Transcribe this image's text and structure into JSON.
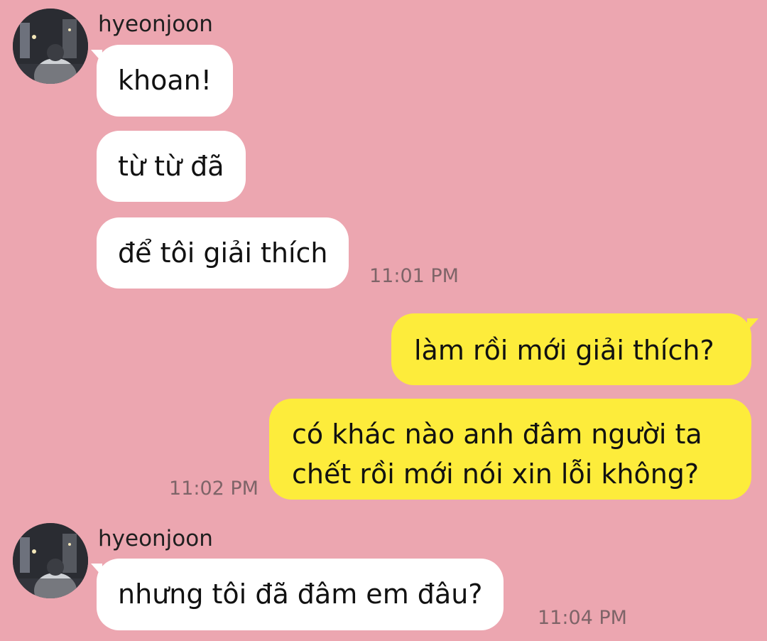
{
  "chat": {
    "groups": [
      {
        "sender": "hyeonjoon",
        "direction": "incoming",
        "messages": [
          "khoan!",
          "từ từ đã",
          "để tôi giải thích"
        ],
        "time": "11:01 PM"
      },
      {
        "sender": "",
        "direction": "outgoing",
        "messages": [
          "làm rồi mới giải thích?",
          "có khác nào anh đâm người ta chết rồi mới nói xin lỗi không?"
        ],
        "time": "11:02 PM"
      },
      {
        "sender": "hyeonjoon",
        "direction": "incoming",
        "messages": [
          "nhưng tôi đã đâm em đâu?"
        ],
        "time": "11:04 PM"
      }
    ]
  },
  "colors": {
    "background": "#eca6b0",
    "incoming_bubble": "#ffffff",
    "outgoing_bubble": "#fdec3b",
    "timestamp": "#7e6468"
  },
  "icons": {
    "avatar": "profile-photo-night-street"
  }
}
